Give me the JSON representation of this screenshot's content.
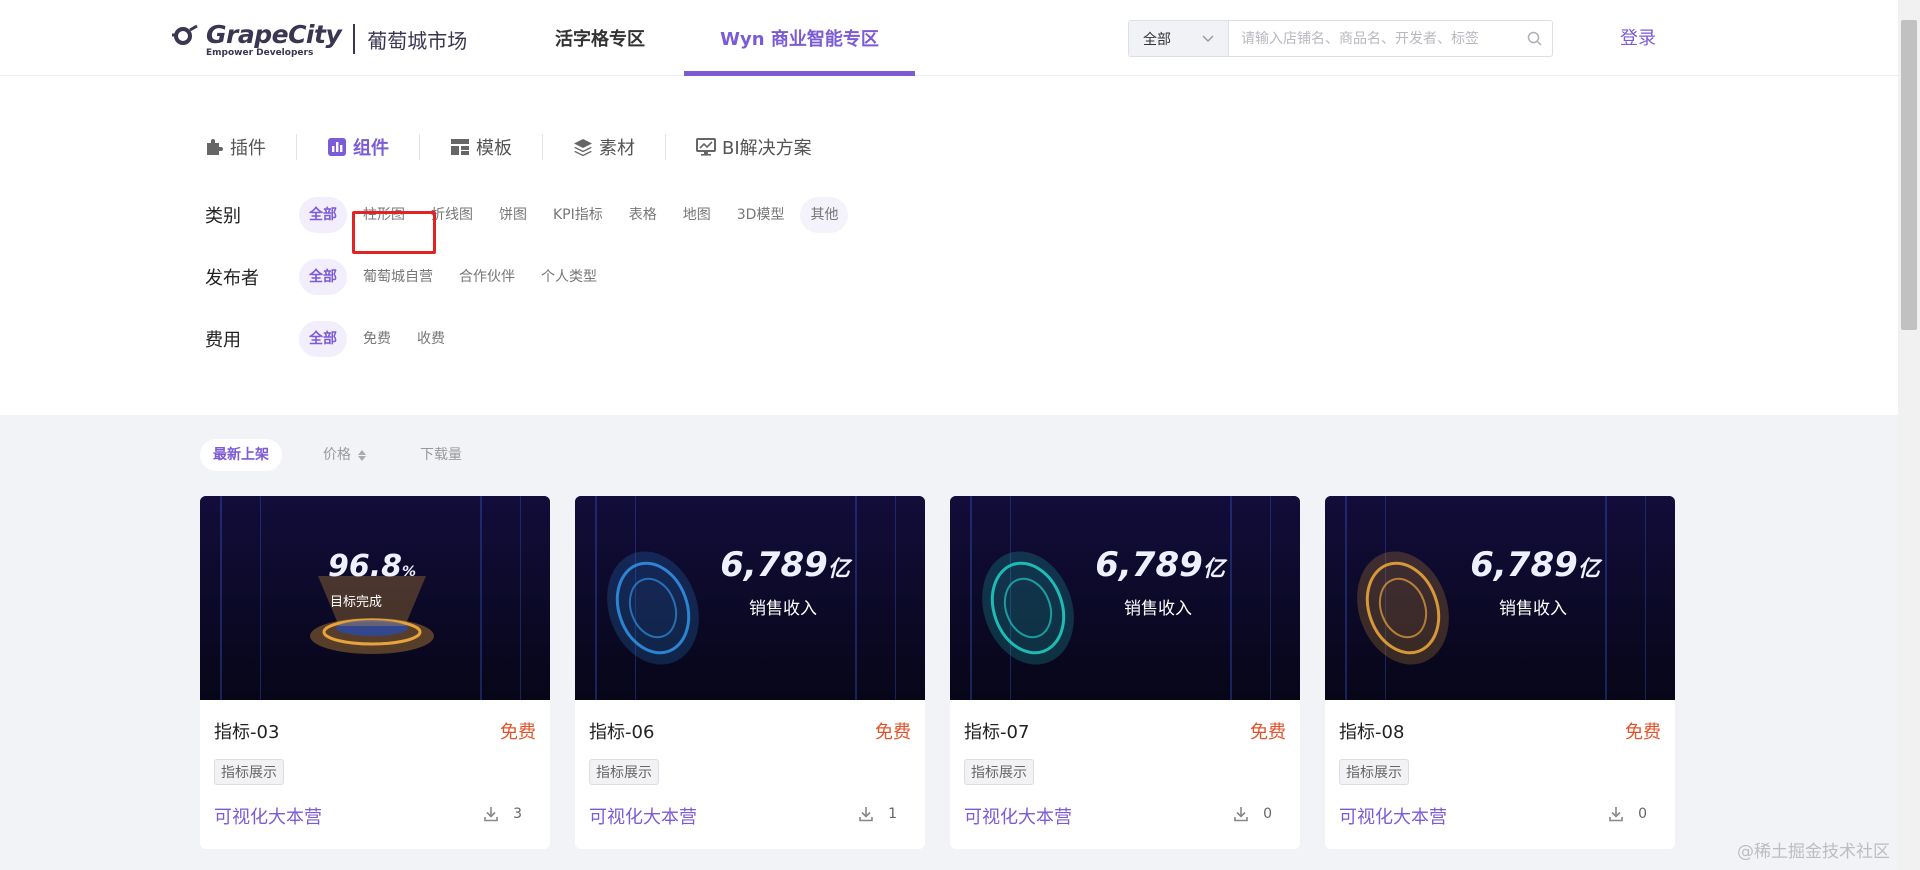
{
  "header": {
    "logo": {
      "brand": "GrapeCity",
      "tagline": "Empower Developers",
      "market": "葡萄城市场"
    },
    "nav_tabs": [
      {
        "label": "活字格专区",
        "active": false
      },
      {
        "label": "Wyn 商业智能专区",
        "active": true
      }
    ],
    "search": {
      "scope": "全部",
      "placeholder": "请输入店铺名、商品名、开发者、标签"
    },
    "login": "登录"
  },
  "types": [
    {
      "label": "插件",
      "icon": "puzzle-icon",
      "active": false
    },
    {
      "label": "组件",
      "icon": "bar-chart-icon",
      "active": true
    },
    {
      "label": "模板",
      "icon": "template-icon",
      "active": false
    },
    {
      "label": "素材",
      "icon": "layers-icon",
      "active": false
    },
    {
      "label": "BI解决方案",
      "icon": "monitor-chart-icon",
      "active": false
    }
  ],
  "filters": {
    "category": {
      "label": "类别",
      "options": [
        "全部",
        "柱形图",
        "折线图",
        "饼图",
        "KPI指标",
        "表格",
        "地图",
        "3D模型",
        "其他"
      ],
      "active": "全部"
    },
    "publisher": {
      "label": "发布者",
      "options": [
        "全部",
        "葡萄城自营",
        "合作伙伴",
        "个人类型"
      ],
      "active": "全部"
    },
    "fee": {
      "label": "费用",
      "options": [
        "全部",
        "免费",
        "收费"
      ],
      "active": "全部"
    }
  },
  "sort": [
    {
      "label": "最新上架",
      "active": true
    },
    {
      "label": "价格",
      "active": false
    },
    {
      "label": "下载量",
      "active": false
    }
  ],
  "cards": [
    {
      "title": "指标-03",
      "price": "免费",
      "tag": "指标展示",
      "author": "可视化大本营",
      "downloads": "3",
      "thumb_value": "96.8",
      "thumb_unit": "%",
      "thumb_caption": "目标完成",
      "accent": "#e8a43a"
    },
    {
      "title": "指标-06",
      "price": "免费",
      "tag": "指标展示",
      "author": "可视化大本营",
      "downloads": "1",
      "thumb_value": "6,789",
      "thumb_unit": "亿",
      "thumb_caption": "销售收入",
      "accent": "#2f8fe0"
    },
    {
      "title": "指标-07",
      "price": "免费",
      "tag": "指标展示",
      "author": "可视化大本营",
      "downloads": "0",
      "thumb_value": "6,789",
      "thumb_unit": "亿",
      "thumb_caption": "销售收入",
      "accent": "#20c9c0"
    },
    {
      "title": "指标-08",
      "price": "免费",
      "tag": "指标展示",
      "author": "可视化大本营",
      "downloads": "0",
      "thumb_value": "6,789",
      "thumb_unit": "亿",
      "thumb_caption": "销售收入",
      "accent": "#e8a43a"
    }
  ],
  "watermark": "@稀土掘金技术社区",
  "colors": {
    "accent": "#7c5bd6",
    "price": "#e0542c",
    "content_bg": "#f2f3f7",
    "highlight": "#e02424"
  }
}
